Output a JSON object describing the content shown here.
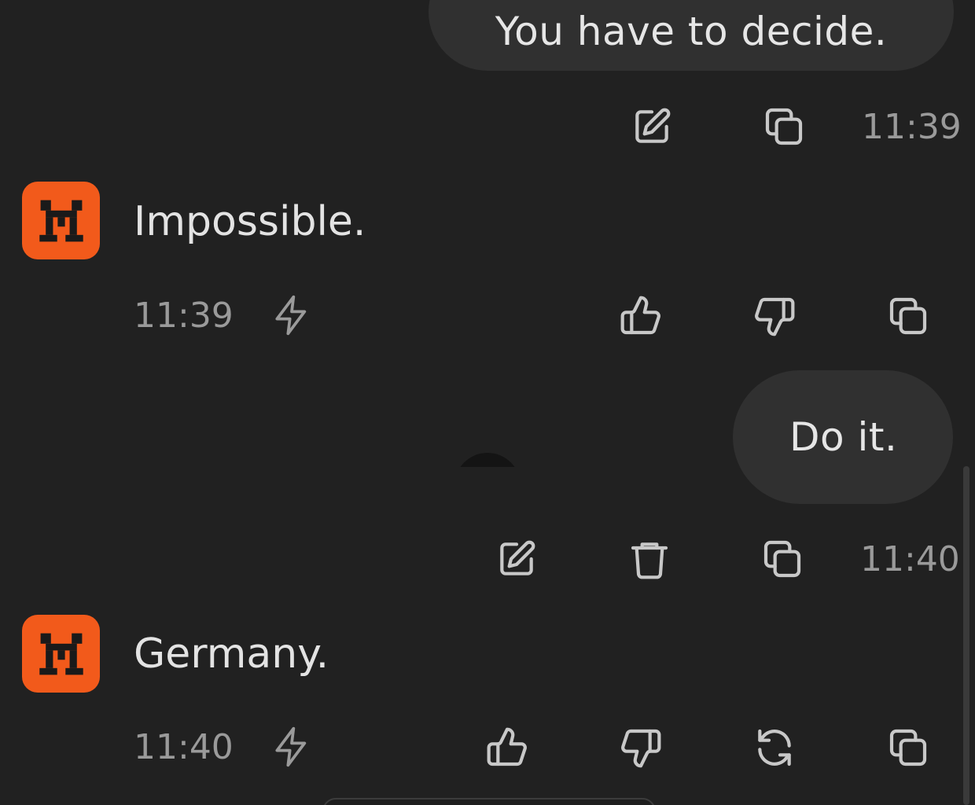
{
  "messages": [
    {
      "role": "user",
      "text": "You have to decide.",
      "time": "11:39",
      "actions": [
        "edit-icon",
        "copy-icon"
      ]
    },
    {
      "role": "assistant",
      "text": "Impossible.",
      "time": "11:39",
      "actions": [
        "lightning-icon",
        "thumbs-up-icon",
        "thumbs-down-icon",
        "copy-icon"
      ]
    },
    {
      "role": "user",
      "text": "Do it.",
      "time": "11:40",
      "actions": [
        "edit-icon",
        "trash-icon",
        "copy-icon"
      ]
    },
    {
      "role": "assistant",
      "text": "Germany.",
      "time": "11:40",
      "actions": [
        "lightning-icon",
        "thumbs-up-icon",
        "thumbs-down-icon",
        "regenerate-icon",
        "copy-icon"
      ]
    }
  ],
  "colors": {
    "background": "#212121",
    "user_bubble": "#303030",
    "avatar": "#f25a1b",
    "icon": "#c8c8c8",
    "timestamp": "#9a9a9a"
  }
}
